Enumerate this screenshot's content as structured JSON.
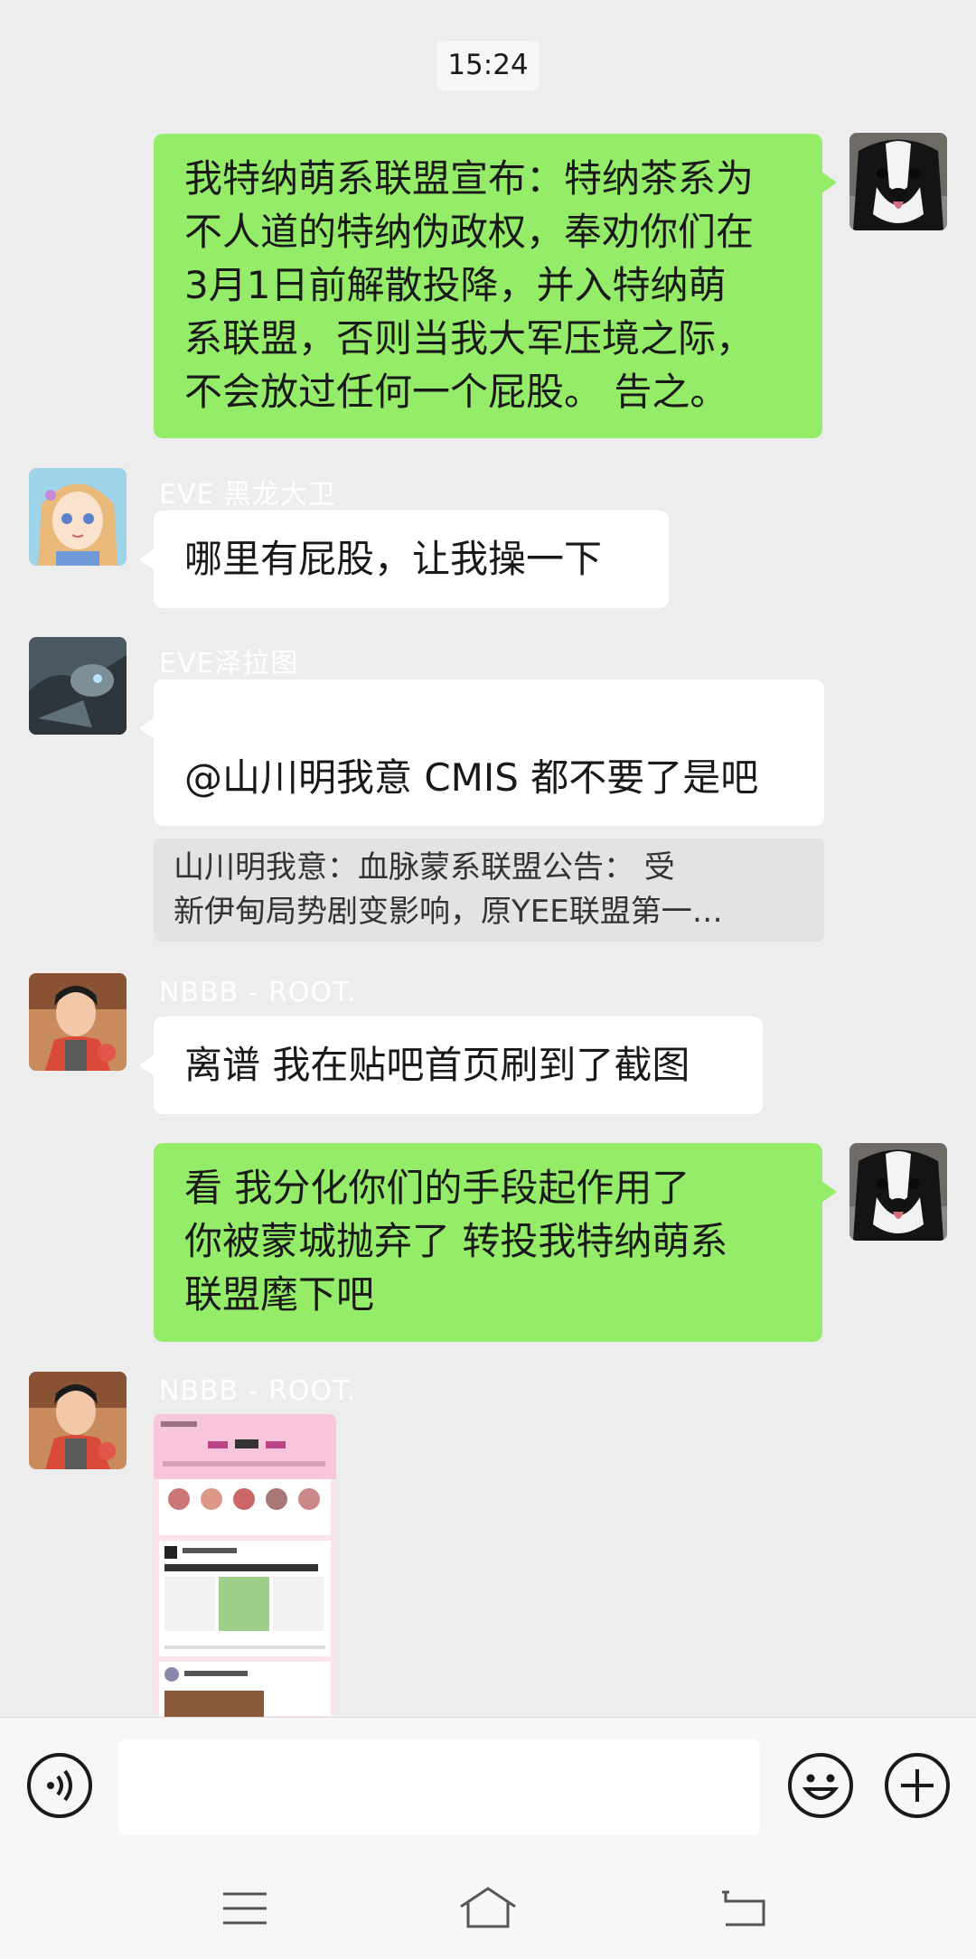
{
  "chat": {
    "time_label": "15:24",
    "messages": [
      {
        "sender": "me",
        "text": "我特纳萌系联盟宣布：特纳茶系为\n不人道的特纳伪政权，奉劝你们在\n3月1日前解散投降，并入特纳萌\n系联盟，否则当我大军压境之际，\n不会放过任何一个屁股。   告之。"
      },
      {
        "sender": "EVE 黑龙大卫",
        "text": "哪里有屁股，让我操一下"
      },
      {
        "sender": "EVE泽拉图",
        "text": "@山川明我意  CMIS 都不要了是吧",
        "emoji": [
          "smile-emoji",
          "smile-emoji",
          "smile-emoji",
          "smile-emoji"
        ],
        "quote_line1": "山川明我意：血脉蒙系联盟公告：       受",
        "quote_line2": "新伊甸局势剧变影响，原YEE联盟第一…"
      },
      {
        "sender": "NBBB - ROOT.",
        "text": "离谱 我在贴吧首页刷到了截图"
      },
      {
        "sender": "me",
        "text": "看  我分化你们的手段起作用了\n你被蒙城抛弃了  转投我特纳萌系\n联盟麾下吧"
      },
      {
        "sender": "NBBB - ROOT.",
        "image": "screenshot-thumbnail"
      }
    ]
  },
  "input_bar": {
    "voice_icon": "voice-icon",
    "emoji_icon": "emoji-icon",
    "plus_icon": "plus-icon",
    "input_value": ""
  },
  "nav_bar": {
    "menu_icon": "menu-icon",
    "home_icon": "home-icon",
    "back_icon": "back-icon"
  },
  "colors": {
    "background": "#ededed",
    "my_bubble": "#95ec69",
    "other_bubble": "#ffffff"
  }
}
